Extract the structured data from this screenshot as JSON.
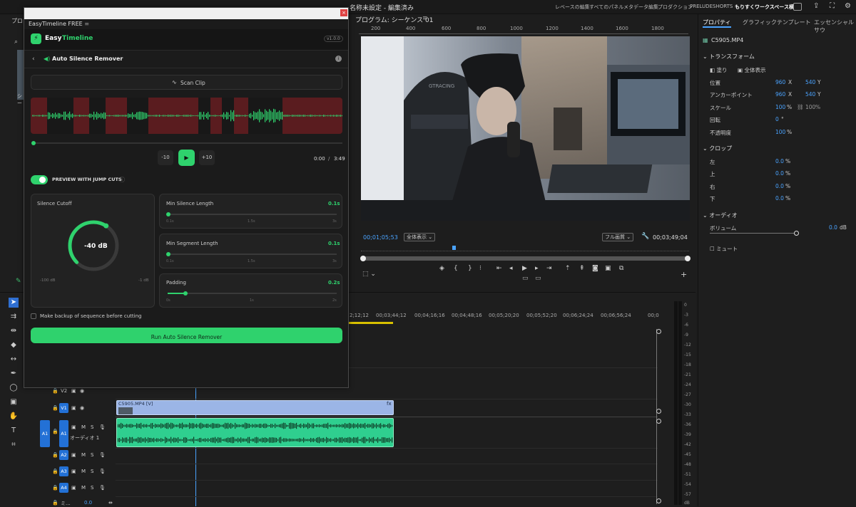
{
  "topbar": {
    "title": "名称未設定 - 編集済み",
    "workspaces": [
      "レベースの編集",
      "すべてのパネル",
      "メタデータ編集",
      "プロダクション",
      "PRELUDE",
      "SHORTS",
      "もりすくワークスペース横"
    ]
  },
  "left_panel": {
    "label_top": "プロ",
    "label_mid": "シー"
  },
  "program": {
    "title": "プログラム: シーケンス 01",
    "ruler": [
      "200",
      "400",
      "600",
      "800",
      "1000",
      "1200",
      "1400",
      "1600",
      "1800"
    ],
    "timecode": "00;01;05;53",
    "zoom": "全体表示",
    "quality": "フル画質",
    "duration": "00;03;49;04",
    "transport_icons": [
      "marker-icon",
      "in-icon",
      "out-icon",
      "goto-in-icon",
      "step-back-icon",
      "play-icon",
      "step-fwd-icon",
      "goto-out-icon",
      "lift-icon",
      "extract-icon",
      "camera-icon",
      "button-editor-icon"
    ]
  },
  "properties": {
    "tabs": [
      "プロパティ",
      "グラフィックテンプレート",
      "エッセンシャルサウ"
    ],
    "clip": "C5905.MP4",
    "transform": {
      "header": "トランスフォーム",
      "fill": "塗り",
      "fit": "全体表示",
      "rows": [
        {
          "label": "位置",
          "x": "960",
          "xu": "X",
          "y": "540",
          "yu": "Y"
        },
        {
          "label": "アンカーポイント",
          "x": "960",
          "xu": "X",
          "y": "540",
          "yu": "Y"
        },
        {
          "label": "スケール",
          "x": "100",
          "xu": "%",
          "y": "100",
          "yu": "%"
        },
        {
          "label": "回転",
          "x": "0",
          "xu": "°"
        },
        {
          "label": "不透明度",
          "x": "100",
          "xu": "%"
        }
      ]
    },
    "crop": {
      "header": "クロップ",
      "rows": [
        {
          "label": "左",
          "v": "0.0",
          "u": "%"
        },
        {
          "label": "上",
          "v": "0.0",
          "u": "%"
        },
        {
          "label": "右",
          "v": "0.0",
          "u": "%"
        },
        {
          "label": "下",
          "v": "0.0",
          "u": "%"
        }
      ]
    },
    "audio": {
      "header": "オーディオ",
      "volume_label": "ボリューム",
      "volume": "0.0",
      "volume_unit": "dB",
      "mute": "ミュート"
    }
  },
  "timeline": {
    "ruler": [
      "2;12;12",
      "00;03;44;12",
      "00;04;16;16",
      "00;04;48;16",
      "00;05;20;20",
      "00;05;52;20",
      "00;06;24;24",
      "00;06;56;24",
      "00;0"
    ],
    "tracks": {
      "v2": "V2",
      "v1": "V1",
      "a1": "A1",
      "a1_name": "オーディオ 1",
      "a2": "A2",
      "a3": "A3",
      "a4": "A4",
      "mix": "ミ...",
      "mix_val": "0.0"
    },
    "clip_label": "C5905.MP4 [V]",
    "m": "M",
    "s": "S",
    "meter_scale": [
      "0",
      "-3",
      "-6",
      "-9",
      "-12",
      "-15",
      "-18",
      "-21",
      "-24",
      "-27",
      "-30",
      "-33",
      "-36",
      "-39",
      "-42",
      "-45",
      "-48",
      "-51",
      "-54",
      "-57",
      "dB"
    ]
  },
  "plugin": {
    "window_title": "EasyTimeline FREE",
    "brand_easy": "Easy",
    "brand_timeline": "Timeline",
    "version": "v1.0.0",
    "page_title": "Auto Silence Remover",
    "scan_label": "Scan Clip",
    "back_label": "-10",
    "fwd_label": "+10",
    "time_current": "0:00",
    "time_sep": "/",
    "time_total": "3:49",
    "preview_label": "PREVIEW WITH JUMP CUTS",
    "silence_cutoff": {
      "label": "Silence Cutoff",
      "value": "-40 dB",
      "fraction": 0.62,
      "min": "-100 dB",
      "max": "-1 dB"
    },
    "min_silence": {
      "label": "Min Silence Length",
      "value": "0.1s",
      "fraction": 0.0,
      "ticks": [
        "0.1s",
        "1.5s",
        "3s"
      ]
    },
    "min_segment": {
      "label": "Min Segment Length",
      "value": "0.1s",
      "fraction": 0.0,
      "ticks": [
        "0.1s",
        "1.5s",
        "3s"
      ]
    },
    "padding": {
      "label": "Padding",
      "value": "0.2s",
      "fraction": 0.1,
      "ticks": [
        "0s",
        "1s",
        "2s"
      ]
    },
    "backup_label": "Make backup of sequence before cutting",
    "run_label": "Run Auto Silence Remover"
  },
  "colors": {
    "accent": "#2fd26d",
    "premiere_blue": "#4aa3ff",
    "track_blue": "#2371d6",
    "silence_red": "#5a1c1f"
  }
}
